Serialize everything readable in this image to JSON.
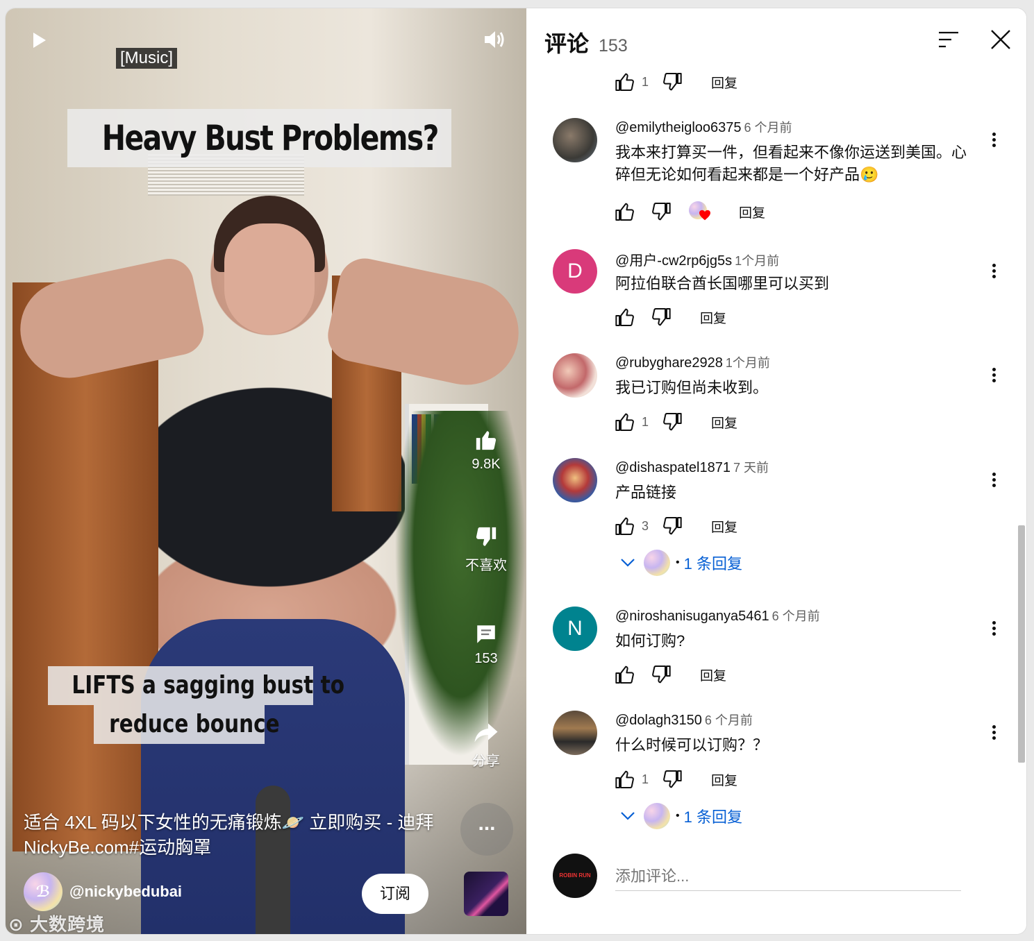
{
  "video": {
    "caption": "[Music]",
    "title_overlay": "Heavy Bust Problems?",
    "overlay_line1": "LIFTS a sagging bust to",
    "overlay_line2": "reduce bounce",
    "like_count": "9.8K",
    "dislike_label": "不喜欢",
    "comment_count": "153",
    "share_label": "分享",
    "more_label": "...",
    "description": "适合 4XL 码以下女性的无痛锻炼🪐 立即购买 - 迪拜 NickyBe.com#运动胸罩",
    "channel": "@nickybedubai",
    "subscribe": "订阅",
    "watermark": "大数跨境"
  },
  "panel": {
    "title": "评论",
    "count": "153",
    "reply_label": "回复",
    "add_comment_placeholder": "添加评论...",
    "top_actions": {
      "likes": "1"
    },
    "comments": [
      {
        "user": "@emilytheigloo6375",
        "time": "6 个月前",
        "text": "我本来打算买一件，但看起来不像你运送到美国。心碎但无论如何看起来都是一个好产品🥲",
        "likes": "",
        "avatar_letter": ""
      },
      {
        "user": "@用户-cw2rp6jg5s",
        "time": "1个月前",
        "text": "阿拉伯联合酋长国哪里可以买到",
        "likes": "",
        "avatar_letter": "D"
      },
      {
        "user": "@rubyghare2928",
        "time": "1个月前",
        "text": "我已订购但尚未收到。",
        "likes": "1",
        "avatar_letter": ""
      },
      {
        "user": "@dishaspatel1871",
        "time": "7 天前",
        "text": "产品链接",
        "likes": "3",
        "avatar_letter": "",
        "replies": "1 条回复"
      },
      {
        "user": "@niroshanisuganya5461",
        "time": "6 个月前",
        "text": "如何订购?",
        "likes": "",
        "avatar_letter": "N"
      },
      {
        "user": "@dolagh3150",
        "time": "6 个月前",
        "text": "什么时候可以订购？？",
        "likes": "1",
        "avatar_letter": "",
        "replies": "1 条回复"
      }
    ]
  },
  "colors": {
    "link": "#065fd4",
    "avatar_d": "#d93a7a",
    "avatar_n": "#00838f",
    "heart": "#ff0000"
  }
}
